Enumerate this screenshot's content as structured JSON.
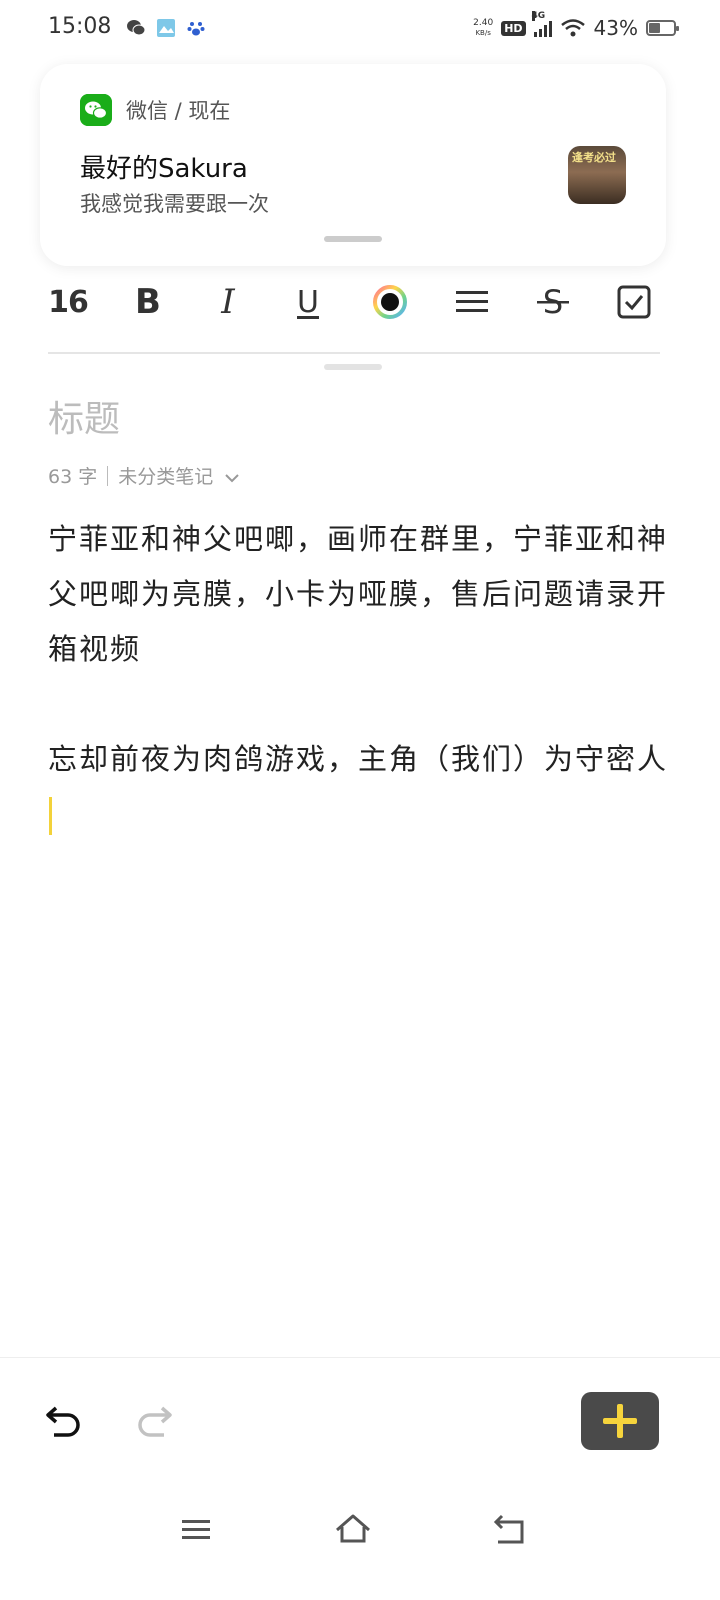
{
  "status": {
    "time": "15:08",
    "net_speed_value": "2.40",
    "net_speed_unit": "KB/s",
    "hd": "HD",
    "net_type": "4G",
    "battery_percent": "43%",
    "battery_level": 0.43,
    "icons": [
      "wechat-icon",
      "app-image-icon",
      "baidu-paw-icon",
      "signal-icon",
      "wifi-icon",
      "battery-icon"
    ]
  },
  "notification": {
    "app_line": "微信 / 现在",
    "sender": "最好的Sakura",
    "message": "我感觉我需要跟一次",
    "thumb_caption": "逢考必过"
  },
  "toolbar": {
    "font_size": "16",
    "bold": "B",
    "italic": "I",
    "underline": "U",
    "strike": "S"
  },
  "note": {
    "title_placeholder": "标题",
    "word_count": "63 字",
    "category": "未分类笔记",
    "paragraphs": [
      "宁菲亚和神父吧唧，画师在群里，宁菲亚和神父吧唧为亮膜，小卡为哑膜，售后问题请录开箱视频",
      "忘却前夜为肉鸽游戏，主角（我们）为守密人"
    ]
  },
  "colors": {
    "wechat_green": "#1aad19",
    "caret": "#f3d23a",
    "add_button_bg": "#4a4a4a",
    "add_button_plus": "#f6d43c"
  }
}
